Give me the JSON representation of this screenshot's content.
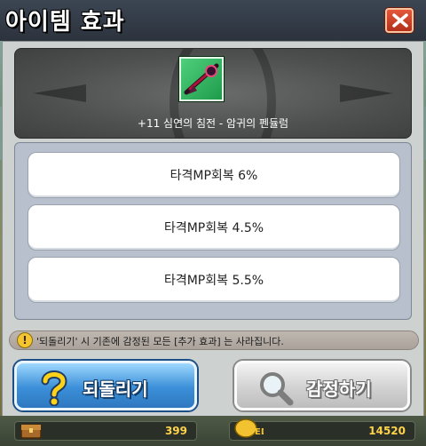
{
  "window": {
    "title": "아이템 효과"
  },
  "item": {
    "name": "+11 심연의 침전 - 암귀의 펜듈럼"
  },
  "effects": [
    {
      "label": "타격MP회복 6%"
    },
    {
      "label": "타격MP회복 4.5%"
    },
    {
      "label": "타격MP회복 5.5%"
    }
  ],
  "notice": {
    "icon_symbol": "!",
    "text": "'되돌리기' 시 기존에 감정된 모든 [추가 효과] 는 사라집니다."
  },
  "buttons": {
    "revert": "되돌리기",
    "appraise": "감정하기"
  },
  "currency": {
    "left_amount": "399",
    "right_amount": "14520",
    "right_icon_text": "ED"
  },
  "icons": {
    "close": "close-icon",
    "revert": "question-mark-icon",
    "appraise": "magnifier-icon",
    "left_currency": "treasure-chest-icon",
    "right_currency": "ed-coin-icon",
    "notice": "exclamation-icon"
  },
  "colors": {
    "accent_blue": "#3b8fd8",
    "close_red": "#c9402a",
    "currency_gold": "#ffd34a"
  }
}
